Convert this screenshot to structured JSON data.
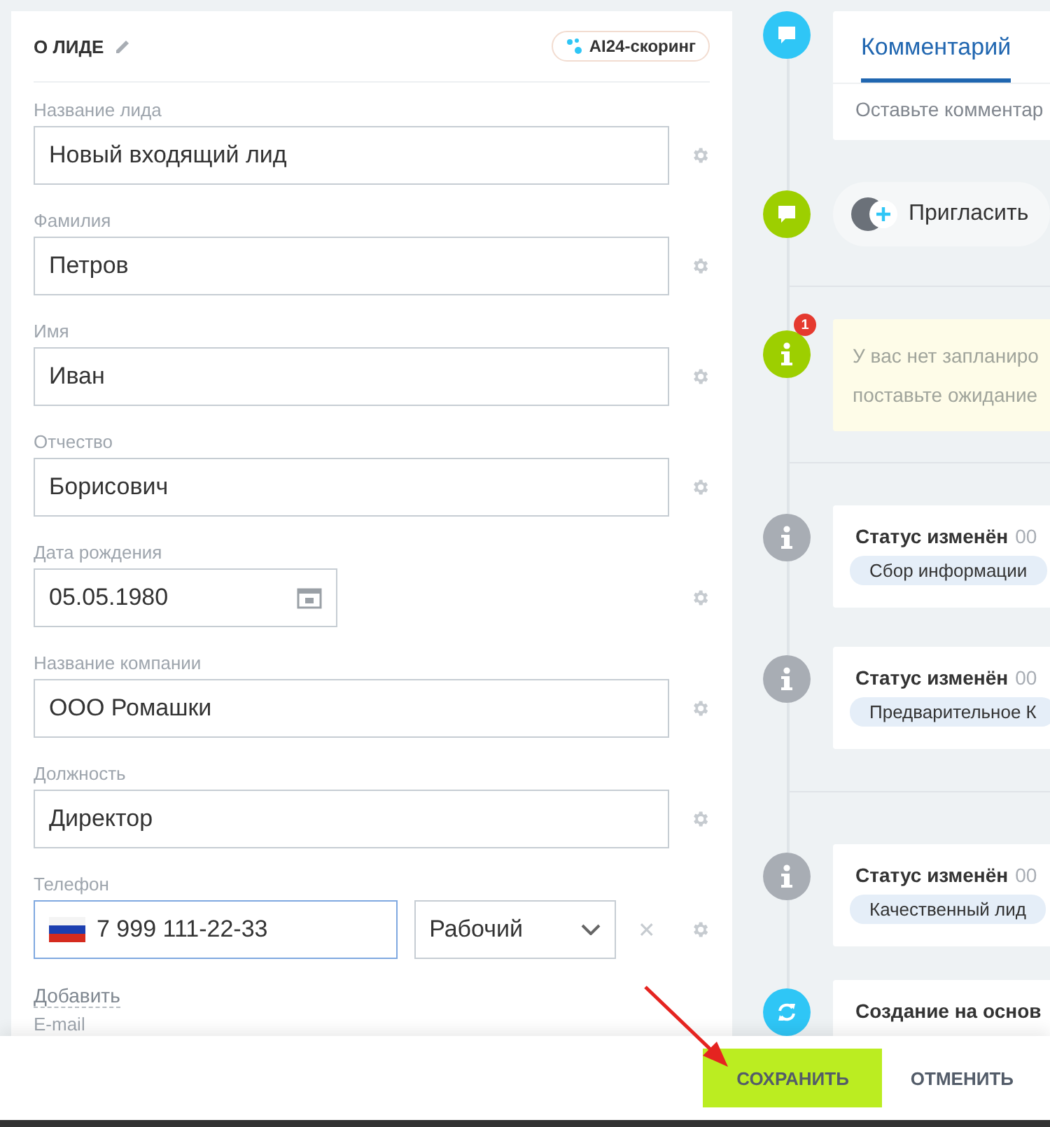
{
  "header": {
    "title": "О ЛИДЕ",
    "scoring_button": "AI24-скоринг"
  },
  "fields": [
    {
      "kind": "text",
      "label": "Название лида",
      "value": "Новый входящий лид"
    },
    {
      "kind": "text",
      "label": "Фамилия",
      "value": "Петров"
    },
    {
      "kind": "text",
      "label": "Имя",
      "value": "Иван"
    },
    {
      "kind": "text",
      "label": "Отчество",
      "value": "Борисович"
    },
    {
      "kind": "date",
      "label": "Дата рождения",
      "value": "05.05.1980"
    },
    {
      "kind": "text",
      "label": "Название компании",
      "value": "ООО Ромашки"
    },
    {
      "kind": "text",
      "label": "Должность",
      "value": "Директор"
    },
    {
      "kind": "phone",
      "label": "Телефон",
      "value": "7 999 111-22-33",
      "phone_type": "Рабочий",
      "focused": true
    }
  ],
  "add_link": "Добавить",
  "next_field_label": "E-mail",
  "timeline": [
    {
      "kind": "comment",
      "tabs": [
        {
          "label": "Комментарий",
          "selected": true
        }
      ],
      "placeholder": "Оставьте комментар"
    },
    {
      "kind": "invite",
      "text": "Пригласить"
    },
    {
      "kind": "divider"
    },
    {
      "kind": "warning",
      "badge": "1",
      "lines": [
        "У вас нет запланиро",
        "поставьте ожидание"
      ]
    },
    {
      "kind": "divider"
    },
    {
      "kind": "status",
      "title": "Статус изменён",
      "time": "00",
      "tag": "Сбор информации"
    },
    {
      "kind": "status",
      "title": "Статус изменён",
      "time": "00",
      "tag": "Предварительное К"
    },
    {
      "kind": "divider"
    },
    {
      "kind": "status",
      "title": "Статус изменён",
      "time": "00",
      "tag": "Качественный лид"
    },
    {
      "kind": "created",
      "title": "Создание на основ"
    }
  ],
  "footer": {
    "buttons": [
      {
        "label": "СОХРАНИТЬ",
        "kind": "primary"
      },
      {
        "label": "ОТМЕНИТЬ",
        "kind": "secondary"
      }
    ]
  }
}
